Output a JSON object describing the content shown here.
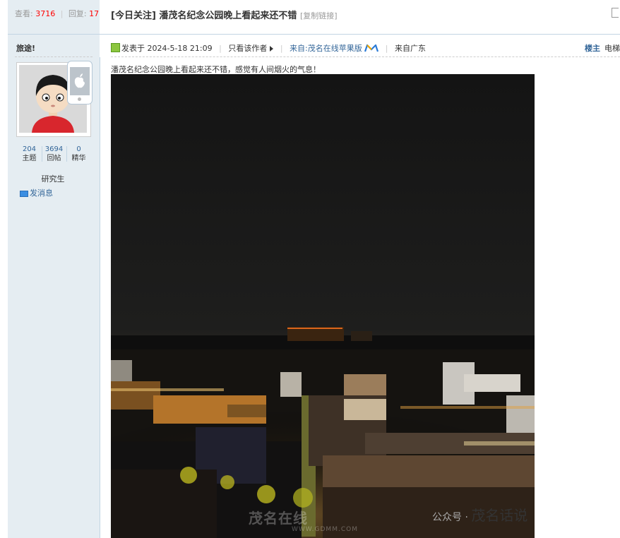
{
  "stats": {
    "views_label": "查看:",
    "views": "3716",
    "replies_label": "回复:",
    "replies": "17"
  },
  "thread": {
    "title": "[今日关注] 潘茂名纪念公园晚上看起来还不错",
    "copy_link": "[复制链接]"
  },
  "author": {
    "name": "旅途!",
    "counts": [
      {
        "value": "204",
        "label": "主题"
      },
      {
        "value": "3694",
        "label": "回帖"
      },
      {
        "value": "0",
        "label": "精华"
      }
    ],
    "rank": "研究生",
    "send_message": "发消息"
  },
  "meta": {
    "posted": "发表于 2024-5-18 21:09",
    "only_author": "只看该作者",
    "source": "来自:茂名在线苹果版",
    "region": "来自广东",
    "floor": "楼主",
    "floor_extra": "电梯"
  },
  "post": {
    "text": "潘茂名纪念公园晚上看起来还不错，感觉有人间烟火的气息！"
  },
  "watermarks": {
    "left_brand": "茂名在线",
    "left_url": "WWW.GDMM.COM",
    "right_prefix": "公众号 · ",
    "right_brand": "茂名话说"
  },
  "icons": [
    "apple-icon",
    "online-status-icon",
    "arrow-right-icon",
    "app-logo-icon",
    "envelope-icon",
    "print-icon"
  ],
  "colors": {
    "link_blue": "#336699",
    "highlight_red": "#ff0000",
    "sidebar_bg": "#e5edf2"
  }
}
